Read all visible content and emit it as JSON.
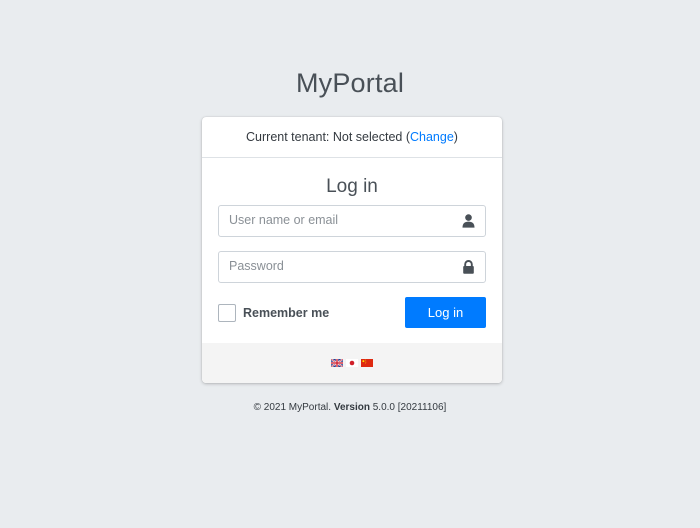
{
  "app_title": "MyPortal",
  "tenant": {
    "label": "Current tenant: Not selected (",
    "link": "Change",
    "close": ")"
  },
  "login": {
    "heading": "Log in",
    "username_placeholder": "User name or email",
    "password_placeholder": "Password",
    "remember_label": "Remember me",
    "submit_label": "Log in"
  },
  "languages": [
    {
      "name": "English",
      "icon": "uk-flag-icon"
    },
    {
      "name": "Japanese",
      "icon": "japan-flag-icon"
    },
    {
      "name": "Chinese",
      "icon": "china-flag-icon"
    }
  ],
  "footer": {
    "copyright": "© 2021 MyPortal. ",
    "version_label": "Version",
    "version_value": " 5.0.0 [20211106]"
  },
  "colors": {
    "background": "#e9ecef",
    "accent": "#007bff"
  }
}
